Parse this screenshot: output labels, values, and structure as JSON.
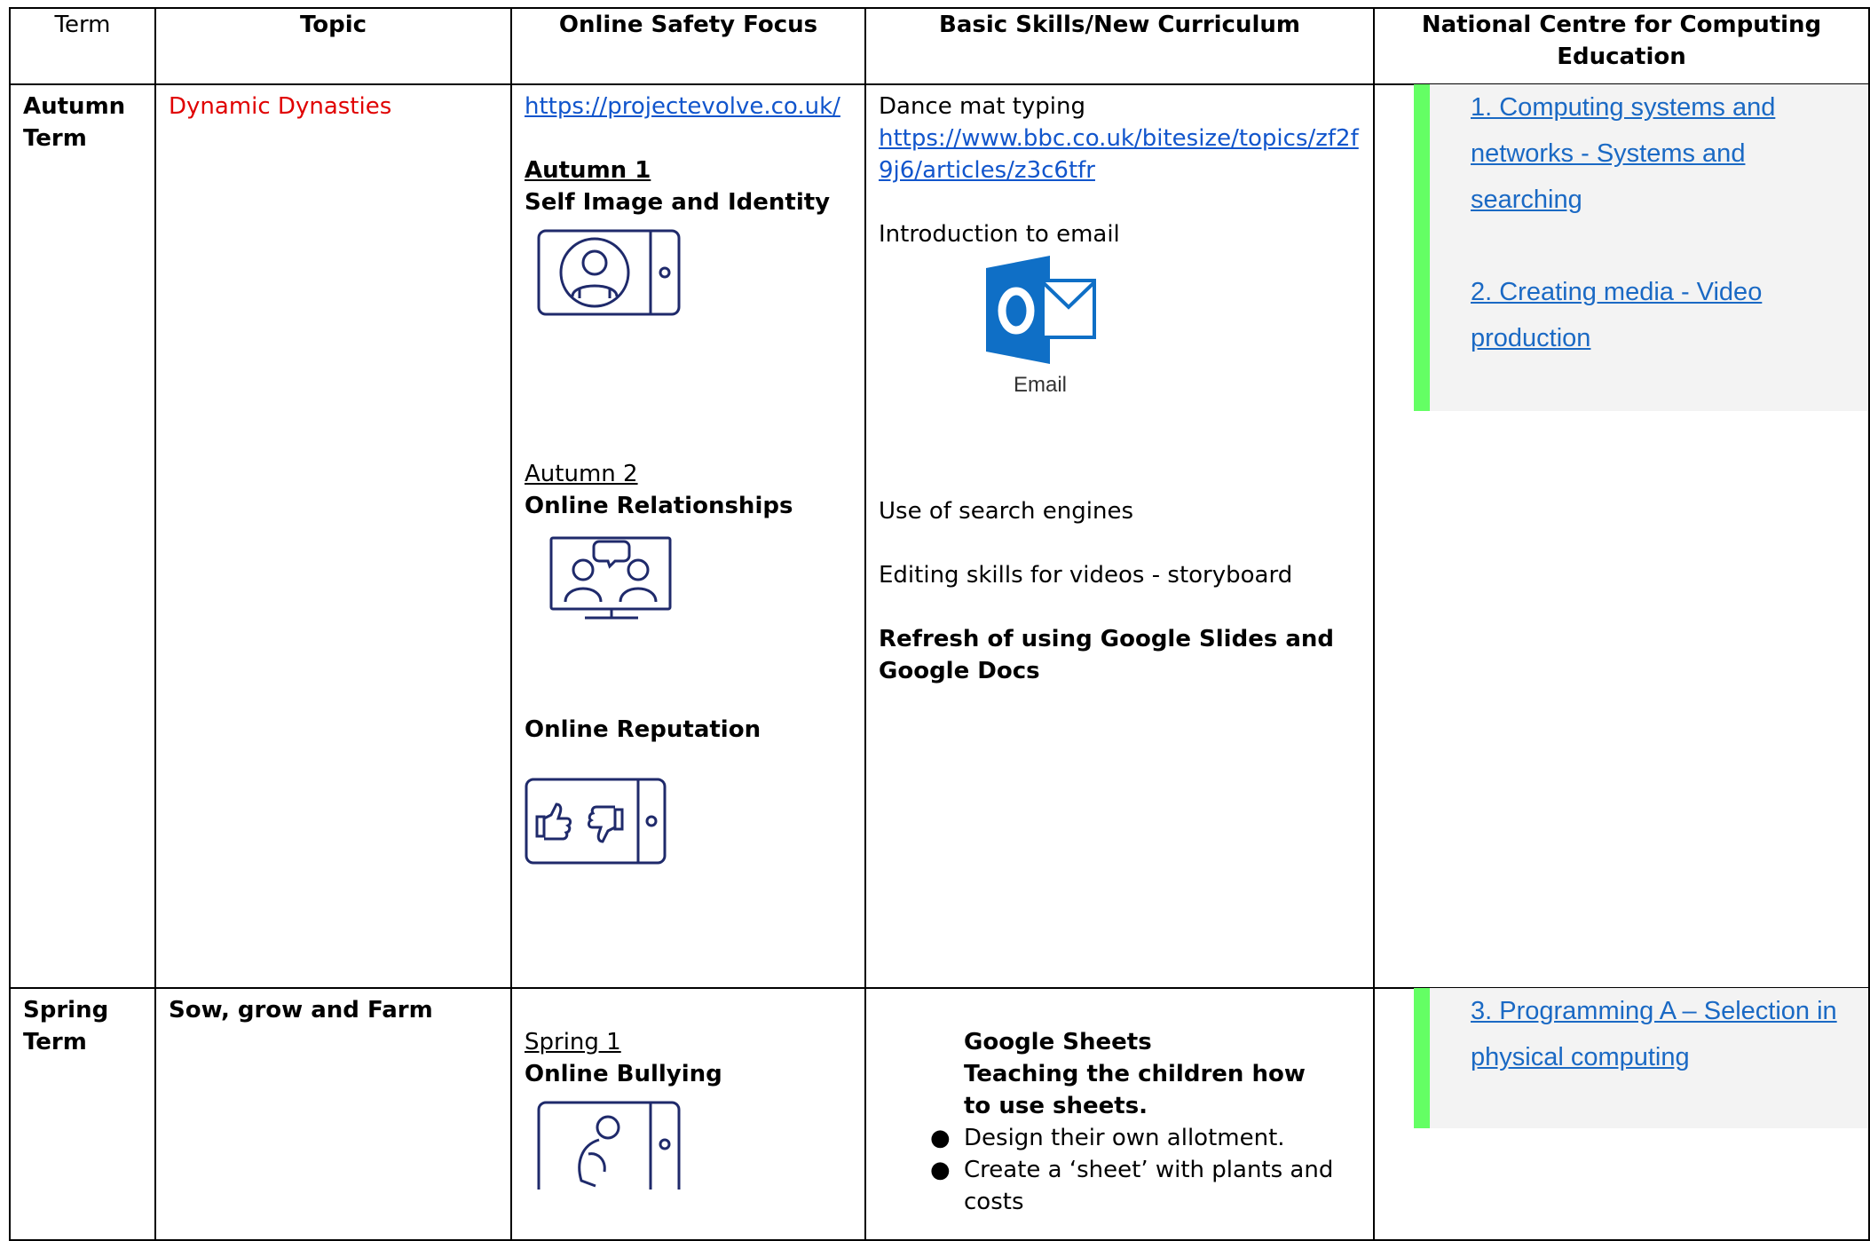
{
  "headers": {
    "term": "Term",
    "topic": "Topic",
    "online_safety": "Online Safety Focus",
    "basic_skills": "Basic Skills/New Curriculum",
    "ncce": "National Centre for Computing Education"
  },
  "autumn": {
    "term": "Autumn Term",
    "topic": "Dynamic Dynasties",
    "safety_link": "https://projectevolve.co.uk/",
    "autumn1_label": "Autumn 1",
    "autumn1_focus": "Self Image and Identity",
    "autumn2_label": "Autumn 2",
    "autumn2_focus": "Online Relationships",
    "reputation_focus": "Online Reputation",
    "dance_mat": "Dance mat typing",
    "dance_mat_link": "https://www.bbc.co.uk/bitesize/topics/zf2f9j6/articles/z3c6tfr",
    "email_intro": "Introduction to email",
    "email_logo_caption": "Email",
    "search_engines": "Use of search engines",
    "editing_skills": "Editing skills for videos - storyboard",
    "refresh": "Refresh of using Google Slides and Google Docs",
    "ncce_links": [
      "1. Computing systems and networks - Systems and searching",
      "2. Creating media - Video production"
    ]
  },
  "spring": {
    "term": "Spring Term",
    "topic": "Sow, grow and Farm",
    "spring1_label": "Spring 1",
    "spring1_focus": "Online Bullying",
    "sheets_title": "Google Sheets",
    "sheets_teaching": "Teaching the children how to use sheets.",
    "bullets": [
      "Design their own allotment.",
      "Create a ‘sheet’ with plants and costs"
    ],
    "bullet_symbol": "●",
    "ncce_link": "3. Programming A – Selection in physical computing"
  },
  "colors": {
    "topic_red": "#e00000",
    "link_blue": "#1155cc",
    "ncce_accent": "#64ff64",
    "ncce_bg": "#f3f3f3",
    "icon_navy": "#1f2a6b",
    "outlook_blue": "#0f6fc6"
  },
  "icons": [
    "self-image-phone-icon",
    "online-relationships-screen-icon",
    "online-reputation-phone-icon",
    "outlook-email-logo",
    "online-bullying-phone-icon"
  ]
}
